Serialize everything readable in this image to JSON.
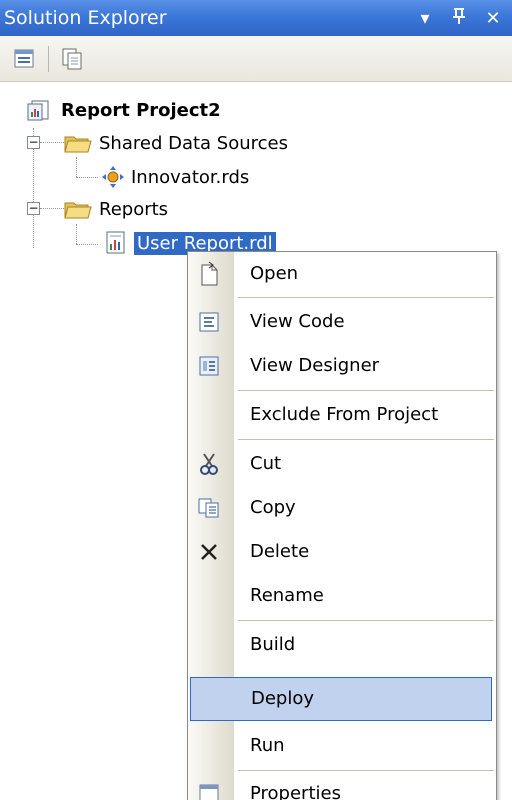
{
  "window": {
    "title": "Solution Explorer"
  },
  "title_controls": [
    {
      "name": "dropdown-icon",
      "glyph": "▾"
    },
    {
      "name": "pin-icon",
      "glyph": "ᵽ"
    },
    {
      "name": "close-icon",
      "glyph": "✕"
    }
  ],
  "toolbar": [
    {
      "name": "properties-icon"
    },
    {
      "name": "show-all-files-icon"
    }
  ],
  "tree": {
    "project": {
      "label": "Report Project2",
      "icon": "report-project-icon"
    },
    "folders": [
      {
        "label": "Shared Data Sources",
        "expander": "−",
        "icon": "folder-icon",
        "items": [
          {
            "label": "Innovator.rds",
            "icon": "data-source-icon"
          }
        ]
      },
      {
        "label": "Reports",
        "expander": "−",
        "icon": "folder-icon",
        "items": [
          {
            "label": "User Report.rdl",
            "icon": "report-file-icon",
            "selected": true
          }
        ]
      }
    ]
  },
  "context_menu": {
    "items": [
      {
        "label": "Open",
        "icon": "open-icon"
      },
      {
        "label": "View Code",
        "icon": "view-code-icon"
      },
      {
        "label": "View Designer",
        "icon": "view-designer-icon"
      },
      {
        "label": "Exclude From Project",
        "icon": ""
      },
      {
        "label": "Cut",
        "icon": "cut-icon"
      },
      {
        "label": "Copy",
        "icon": "copy-icon"
      },
      {
        "label": "Delete",
        "icon": "delete-icon"
      },
      {
        "label": "Rename",
        "icon": ""
      },
      {
        "label": "Build",
        "icon": ""
      },
      {
        "label": "Deploy",
        "icon": "",
        "highlighted": true
      },
      {
        "label": "Run",
        "icon": ""
      },
      {
        "label": "Properties",
        "icon": "properties-icon"
      }
    ]
  },
  "colors": {
    "titlebar": "#3c77d9",
    "selection": "#316ac5",
    "menu_highlight": "#c1d2ee"
  }
}
